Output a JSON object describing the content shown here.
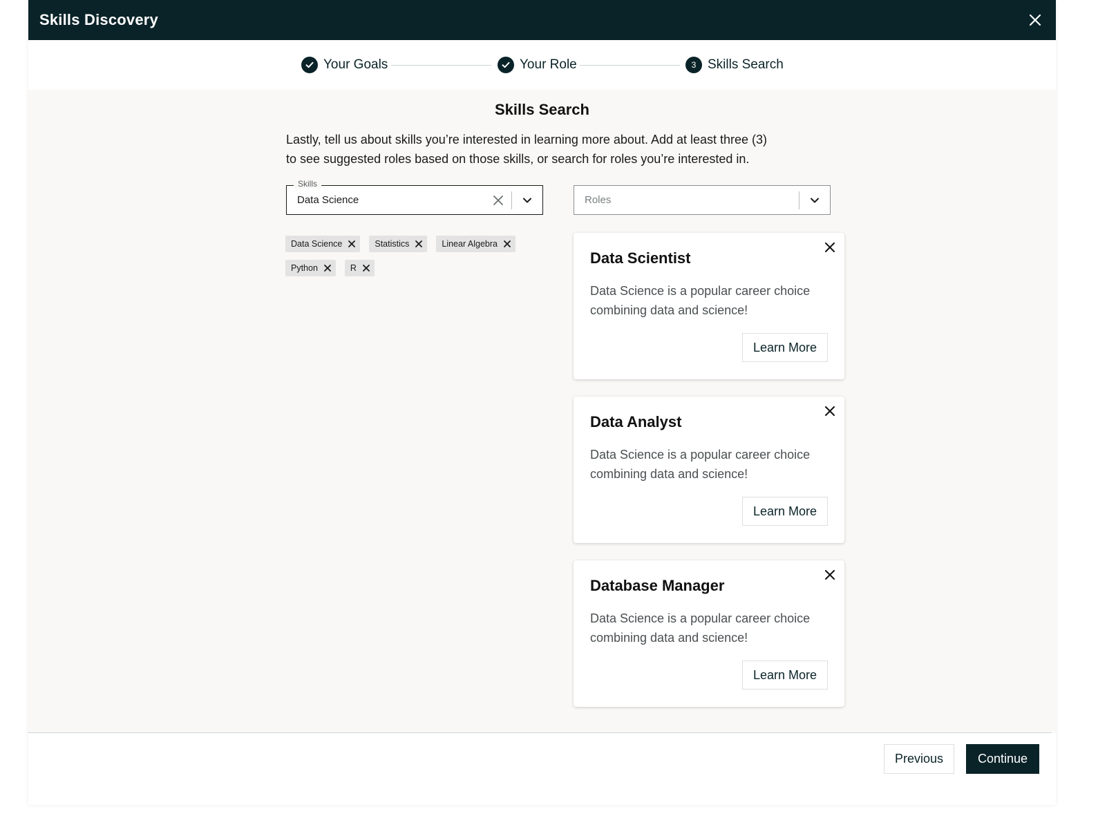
{
  "header": {
    "title": "Skills Discovery",
    "close_icon": "close-icon"
  },
  "stepper": {
    "steps": [
      {
        "label": "Your Goals",
        "state": "complete",
        "icon": "check-circle-icon"
      },
      {
        "label": "Your Role",
        "state": "complete",
        "icon": "check-circle-icon"
      },
      {
        "label": "Skills Search",
        "state": "current",
        "number": "3"
      }
    ]
  },
  "main": {
    "title": "Skills Search",
    "description_line1": "Lastly, tell us about skills you’re interested in learning more about. Add at least three (3)",
    "description_line2": "to see suggested roles based on those skills, or search for roles you’re interested in.",
    "skills_field": {
      "label": "Skills",
      "value": "Data Science"
    },
    "roles_field": {
      "placeholder": "Roles"
    },
    "tags": [
      "Data Science",
      "Statistics",
      "Linear Algebra",
      "Python",
      "R"
    ],
    "role_cards": [
      {
        "title": "Data Scientist",
        "description": "Data Science is a popular career choice combining data and science!",
        "button": "Learn More"
      },
      {
        "title": "Data Analyst",
        "description": "Data Science is a popular career choice combining data and science!",
        "button": "Learn More"
      },
      {
        "title": "Database Manager",
        "description": "Data Science is a popular career choice combining data and science!",
        "button": "Learn More"
      }
    ]
  },
  "footer": {
    "previous_label": "Previous",
    "continue_label": "Continue"
  },
  "colors": {
    "primary": "#0a2328",
    "background": "#f9f8f6",
    "tag_bg": "#e3e3e3"
  }
}
